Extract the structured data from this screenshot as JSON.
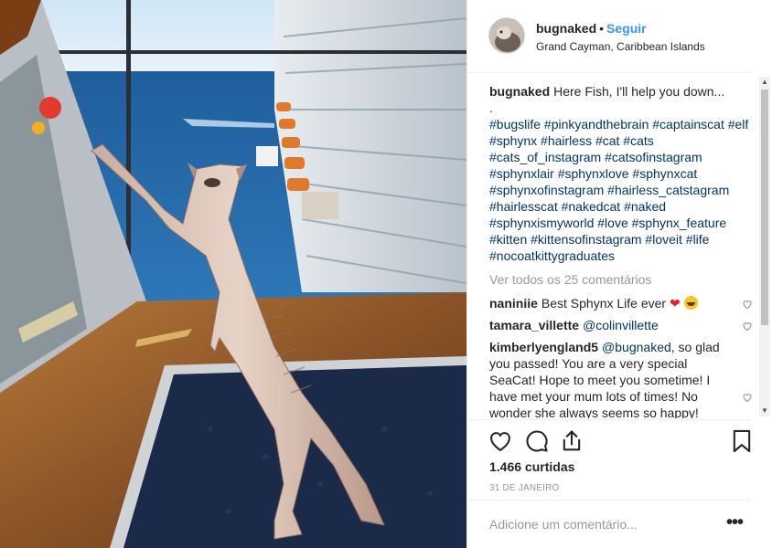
{
  "header": {
    "username": "bugnaked",
    "separator": "•",
    "follow_label": "Seguir",
    "location": "Grand Cayman, Caribbean Islands"
  },
  "caption": {
    "username": "bugnaked",
    "text": "Here Fish, I'll help you down...",
    "dot": ".",
    "hashtags": "#bugslife #pinkyandthebrain #captainscat #elf #sphynx #hairless #cat #cats #cats_of_instagram #catsofinstagram #sphynxlair #sphynxlove #sphynxcat #sphynxofinstagram #hairless_catstagram #hairlesscat #nakedcat #naked #sphynxismyworld #love #sphynx_feature #kitten #kittensofinstagram #loveit #life #nocoatkittygraduates"
  },
  "view_all_label": "Ver todos os 25 comentários",
  "comments": [
    {
      "username": "naniniie",
      "text": "Best Sphynx Life ever"
    },
    {
      "username": "tamara_villette",
      "mention": "@colinvillette",
      "text": ""
    },
    {
      "username": "kimberlyengland5",
      "mention": "@bugnaked",
      "text": ", so glad you passed! You are a very special SeaCat! Hope to meet you sometime! I have met your mum lots of times! No wonder she always seems so happy!"
    }
  ],
  "likes_label": "1.466 curtidas",
  "date_label": "31 DE JANEIRO",
  "add_comment_placeholder": "Adicione um comentário...",
  "more_label": "•••",
  "icons": {
    "like": "heart-icon",
    "comment": "comment-icon",
    "share": "share-icon",
    "save": "bookmark-icon",
    "comment_like": "heart-icon"
  },
  "colors": {
    "link": "#3897f0",
    "hashtag": "#003569",
    "muted": "#999999",
    "text": "#262626"
  }
}
